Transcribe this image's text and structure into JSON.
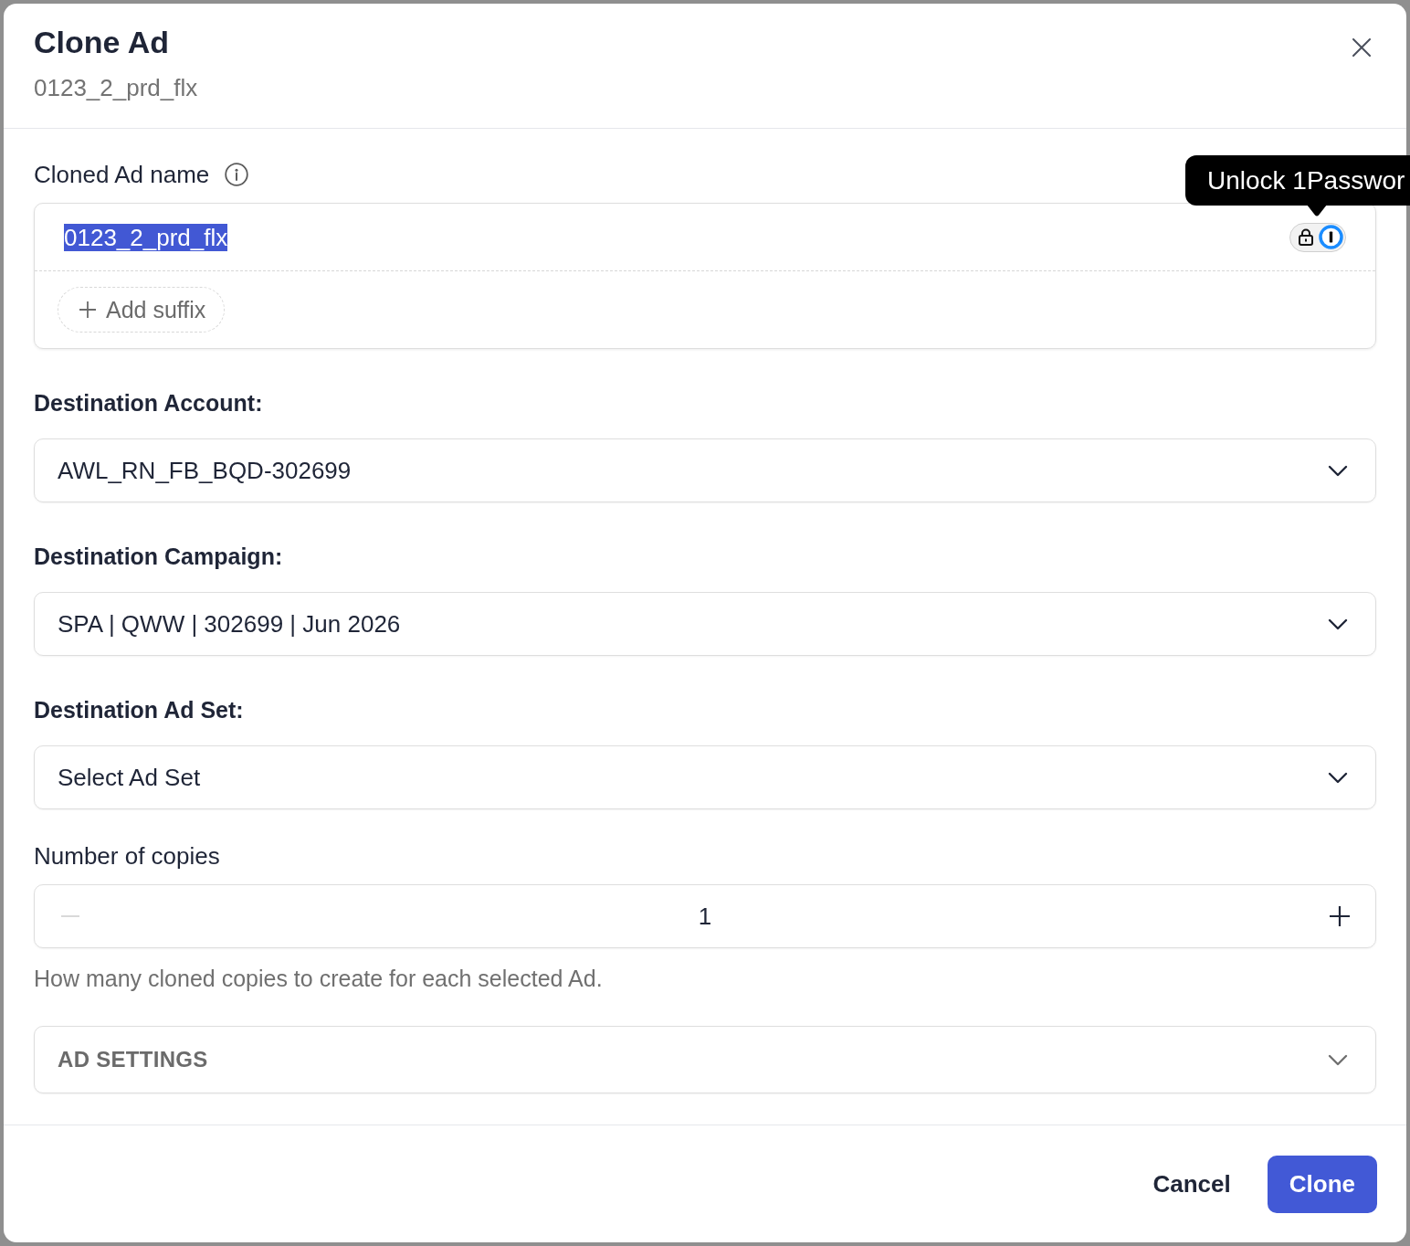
{
  "dialog": {
    "title": "Clone Ad",
    "subtitle": "0123_2_prd_flx"
  },
  "name_field": {
    "label": "Cloned Ad name",
    "value": "0123_2_prd_flx",
    "highlighted": true,
    "suffix_button": "Add suffix"
  },
  "password_manager": {
    "tooltip": "Unlock 1Passwor"
  },
  "fields": [
    {
      "kind": "select",
      "label": "Destination Account:",
      "value": "AWL_RN_FB_BQD-302699"
    },
    {
      "kind": "select",
      "label": "Destination Campaign:",
      "value": "SPA | QWW | 302699 | Jun 2026"
    },
    {
      "kind": "select",
      "label": "Destination Ad Set:",
      "placeholder": "Select Ad Set"
    },
    {
      "kind": "stepper",
      "label": "Number of copies",
      "value": "1",
      "decrement_disabled": true,
      "help": "How many cloned copies to create for each selected Ad."
    }
  ],
  "accordion": {
    "title": "AD SETTINGS",
    "expanded": false
  },
  "footer": {
    "buttons": [
      {
        "kind": "secondary",
        "label": "Cancel"
      },
      {
        "kind": "primary",
        "label": "Clone"
      }
    ]
  }
}
